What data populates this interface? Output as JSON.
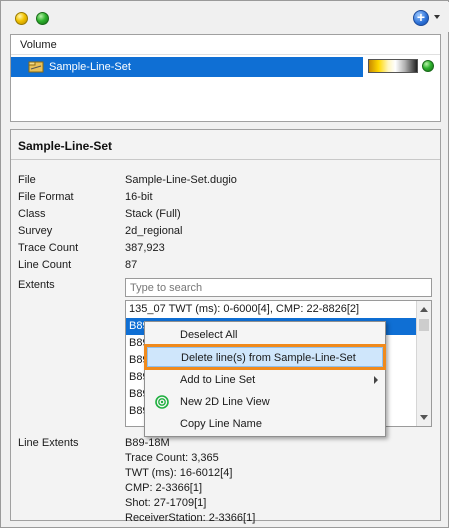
{
  "toolbar": {
    "icons": [
      "yellow-status-dot",
      "green-status-dot",
      "add-icon",
      "chevron-down-icon"
    ]
  },
  "volume_list": {
    "header": "Volume",
    "items": [
      {
        "label": "Sample-Line-Set",
        "selected": true,
        "icon": "line-set-icon",
        "status_color": "#2eb32e"
      }
    ]
  },
  "properties": {
    "title": "Sample-Line-Set",
    "rows": [
      {
        "label": "File",
        "value": "Sample-Line-Set.dugio"
      },
      {
        "label": "File Format",
        "value": "16-bit"
      },
      {
        "label": "Class",
        "value": "Stack (Full)"
      },
      {
        "label": "Survey",
        "value": "2d_regional"
      },
      {
        "label": "Trace Count",
        "value": "387,923"
      },
      {
        "label": "Line Count",
        "value": "87"
      }
    ],
    "extents_label": "Extents",
    "search_placeholder": "Type to search",
    "extents_list": [
      {
        "text": "135_07 TWT (ms): 0-6000[4], CMP: 22-8826[2]",
        "selected": false
      },
      {
        "text": "B89",
        "selected": true
      },
      {
        "text": "B89",
        "selected": false
      },
      {
        "text": "B89",
        "selected": false
      },
      {
        "text": "B89",
        "selected": false
      },
      {
        "text": "B89",
        "selected": false
      },
      {
        "text": "B89",
        "selected": false
      },
      {
        "text": "B89",
        "selected": false
      }
    ],
    "line_extents_label": "Line Extents",
    "line_extents_values": [
      "B89-18M",
      "Trace Count: 3,365",
      "TWT (ms): 16-6012[4]",
      "CMP: 2-3366[1]",
      "Shot: 27-1709[1]",
      "ReceiverStation: 2-3366[1]"
    ]
  },
  "context_menu": {
    "items": [
      {
        "label": "Deselect All",
        "highlighted": false,
        "submenu": false,
        "icon": ""
      },
      {
        "label": "Delete line(s) from Sample-Line-Set",
        "highlighted": true,
        "submenu": false,
        "icon": ""
      },
      {
        "label": "Add to Line Set",
        "highlighted": false,
        "submenu": true,
        "icon": ""
      },
      {
        "label": "New 2D Line View",
        "highlighted": false,
        "submenu": false,
        "icon": "2d-line-view-icon"
      },
      {
        "label": "Copy Line Name",
        "highlighted": false,
        "submenu": false,
        "icon": ""
      }
    ]
  },
  "colors": {
    "selection": "#0f6fd4",
    "highlight_outline": "#f08a1c",
    "status_green": "#2eb32e",
    "status_yellow": "#f2c300",
    "add_blue": "#2a6fd6"
  }
}
